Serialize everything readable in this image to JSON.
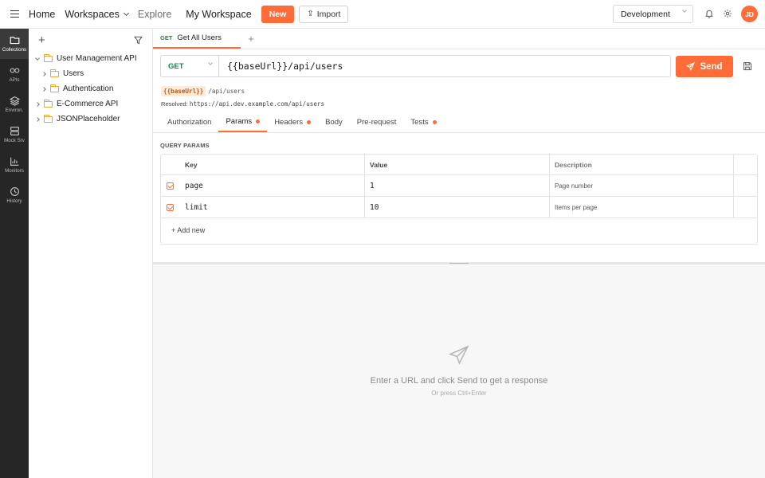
{
  "topbar": {
    "home": "Home",
    "workspaces": "Workspaces",
    "explore": "Explore",
    "workspace_title": "My Workspace",
    "new_label": "New",
    "import_label": "Import",
    "environment": "Development",
    "avatar_initials": "JD"
  },
  "rail": {
    "items": [
      {
        "label": "Collections",
        "icon": "folder-icon",
        "active": true
      },
      {
        "label": "APIs",
        "icon": "link-icon"
      },
      {
        "label": "Environ.",
        "icon": "layers-icon"
      },
      {
        "label": "Mock Srv",
        "icon": "server-icon"
      },
      {
        "label": "Monitors",
        "icon": "chart-icon"
      },
      {
        "label": "History",
        "icon": "clock-icon"
      }
    ]
  },
  "sidebar": {
    "tree": [
      {
        "label": "User Management API",
        "expanded": true,
        "level": 0
      },
      {
        "label": "Users",
        "expanded": false,
        "level": 1
      },
      {
        "label": "Authentication",
        "expanded": false,
        "level": 1
      },
      {
        "label": "E-Commerce API",
        "expanded": false,
        "level": 0
      },
      {
        "label": "JSONPlaceholder",
        "expanded": false,
        "level": 0
      }
    ]
  },
  "request": {
    "tab": {
      "method": "GET",
      "name": "Get All Users"
    },
    "method": "GET",
    "url": "{{baseUrl}}/api/users",
    "send_label": "Send",
    "var_chip": "{{baseUrl}}",
    "var_path": "/api/users",
    "resolved_label": "Resolved:",
    "resolved_url": "https://api.dev.example.com/api/users",
    "subtabs": [
      {
        "label": "Authorization",
        "dot": false
      },
      {
        "label": "Params",
        "dot": true,
        "active": true
      },
      {
        "label": "Headers",
        "dot": true
      },
      {
        "label": "Body",
        "dot": false
      },
      {
        "label": "Pre-request",
        "dot": false
      },
      {
        "label": "Tests",
        "dot": true
      }
    ]
  },
  "params": {
    "title": "QUERY PARAMS",
    "headers": {
      "key": "Key",
      "value": "Value",
      "description": "Description"
    },
    "rows": [
      {
        "enabled": true,
        "key": "page",
        "value": "1",
        "description": "Page number"
      },
      {
        "enabled": true,
        "key": "limit",
        "value": "10",
        "description": "Items per page"
      }
    ],
    "add_new": "+ Add new"
  },
  "response": {
    "empty_main": "Enter a URL and click Send to get a response",
    "empty_sub": "Or press Ctrl+Enter"
  },
  "colors": {
    "accent": "#ff6c37",
    "method_get": "#0c8a4a",
    "folder": "#e7a92b"
  }
}
